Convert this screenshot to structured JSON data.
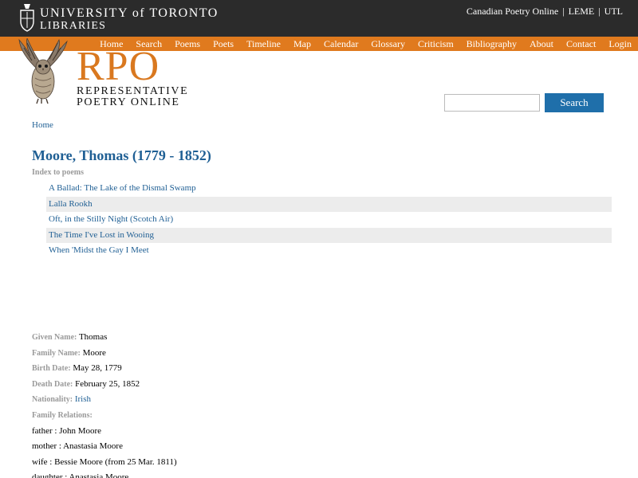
{
  "header": {
    "university_line1": "UNIVERSITY of TORONTO",
    "university_line2": "LIBRARIES",
    "links": [
      "Canadian Poetry Online",
      "LEME",
      "UTL"
    ],
    "separator": "|"
  },
  "nav": {
    "items": [
      "Home",
      "Search",
      "Poems",
      "Poets",
      "Timeline",
      "Map",
      "Calendar",
      "Glossary",
      "Criticism",
      "Bibliography",
      "About",
      "Contact",
      "Login"
    ]
  },
  "logo": {
    "acronym": "RPO",
    "line1": "REPRESENTATIVE",
    "line2": "POETRY ONLINE"
  },
  "search": {
    "value": "",
    "button_label": "Search"
  },
  "breadcrumb": "Home",
  "poet": {
    "title": "Moore, Thomas (1779 - 1852)",
    "index_label": "Index to poems",
    "poems": [
      "A Ballad: The Lake of the Dismal Swamp",
      "Lalla Rookh",
      "Oft, in the Stilly Night (Scotch Air)",
      "The Time I've Lost in Wooing",
      "When 'Midst the Gay I Meet"
    ]
  },
  "bio": {
    "given_name_label": "Given Name:",
    "given_name": "Thomas",
    "family_name_label": "Family Name:",
    "family_name": "Moore",
    "birth_label": "Birth Date:",
    "birth": "May 28, 1779",
    "death_label": "Death Date:",
    "death": "February 25, 1852",
    "nationality_label": "Nationality:",
    "nationality": "Irish",
    "relations_label": "Family Relations:",
    "relations": [
      "father : John Moore",
      "mother : Anastasia Moore",
      "wife : Bessie Moore (from 25 Mar. 1811)",
      "daughter : Anastasia Moore"
    ]
  },
  "icons": {
    "crest": "university-crest-icon",
    "owl": "owl-logo-icon"
  },
  "colors": {
    "top_bar": "#2b2b2b",
    "nav_bar": "#e07a1e",
    "link": "#1f5f94",
    "button": "#1f6faa",
    "logo_orange": "#d9781f"
  }
}
